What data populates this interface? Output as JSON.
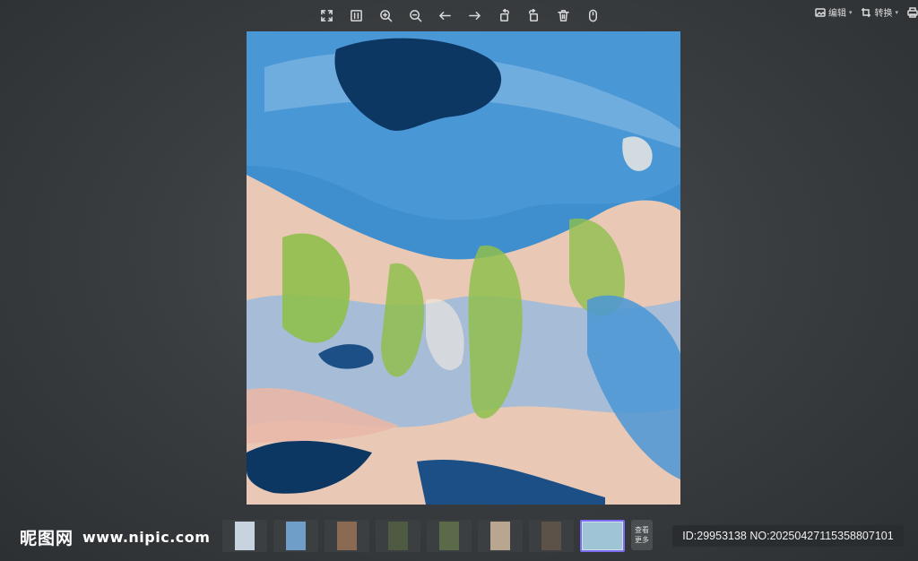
{
  "toolbar": {
    "icons": [
      "fullscreen-icon",
      "fit-window-icon",
      "zoom-in-icon",
      "zoom-out-icon",
      "arrow-left-icon",
      "arrow-right-icon",
      "rotate-left-icon",
      "rotate-right-icon",
      "trash-icon",
      "mouse-icon"
    ]
  },
  "right_tools": {
    "edit_label": "编辑",
    "convert_label": "转换"
  },
  "image": {
    "palette": [
      "#3f8fcf",
      "#1b4f86",
      "#0d3763",
      "#7fb6e2",
      "#e9c8b5",
      "#8fbf4d",
      "#a7bcd6",
      "#f3ece2"
    ]
  },
  "watermark": {
    "cn": "昵图网",
    "url": "www.nipic.com"
  },
  "thumbnails": {
    "items": [
      {
        "color": "#c7d4e0"
      },
      {
        "color": "#6f9fc8"
      },
      {
        "color": "#8a6a52"
      },
      {
        "color": "#4f5a42"
      },
      {
        "color": "#5b6a48"
      },
      {
        "color": "#b8a690"
      },
      {
        "color": "#5c5248"
      },
      {
        "color": "#9fc4d6"
      }
    ],
    "more_line1": "查看",
    "more_line2": "更多"
  },
  "id_text": "ID:29953138 NO:20250427115358807101"
}
